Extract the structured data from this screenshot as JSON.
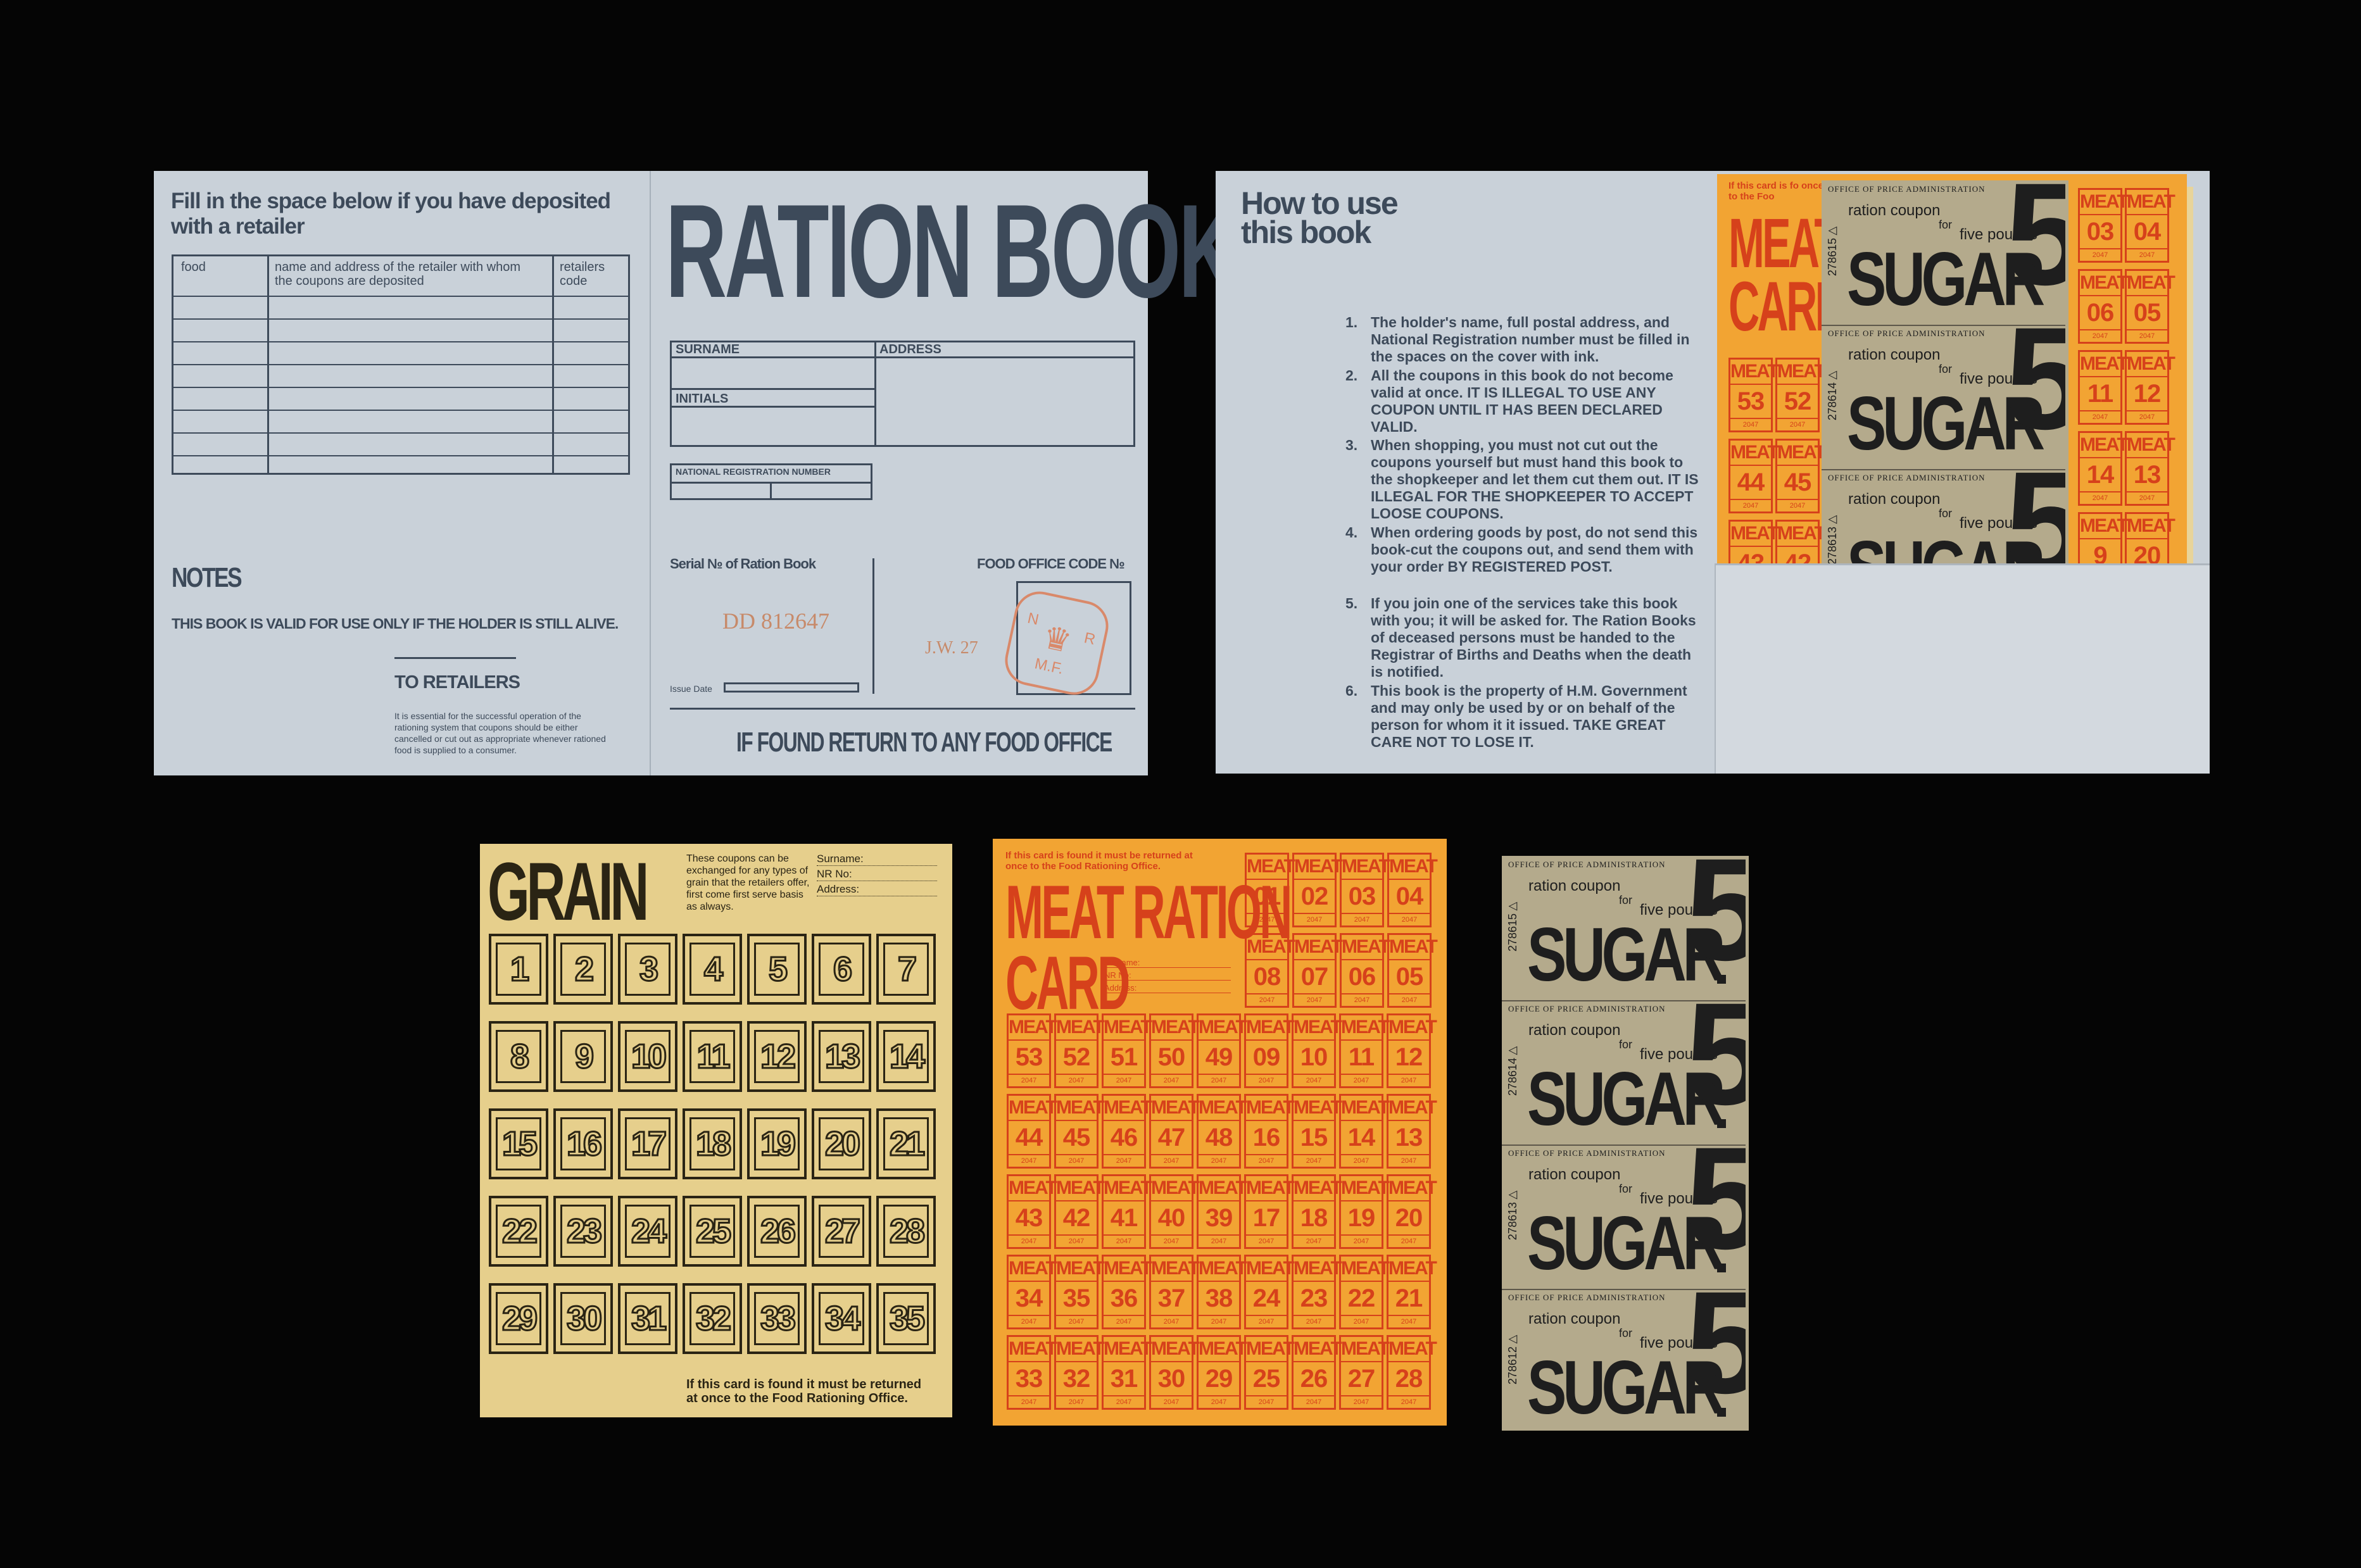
{
  "ration_book_cover": {
    "deposit_heading": "Fill in the space below if you have deposited with a retailer",
    "table_headers": [
      "food",
      "name and address of the retailer with whom the coupons are deposited",
      "retailers code"
    ],
    "notes_title": "NOTES",
    "validity_note": "THIS BOOK IS VALID FOR USE ONLY IF THE HOLDER IS STILL ALIVE.",
    "retailers_title": "TO RETAILERS",
    "retailers_text": "It is essential for the successful operation of the rationing system that coupons should be either cancelled or cut out as appropriate whenever rationed food is supplied to a consumer.",
    "title": "RATION BOOK",
    "field_surname": "SURNAME",
    "field_address": "ADDRESS",
    "field_initials": "INITIALS",
    "field_nrn": "NATIONAL REGISTRATION NUMBER",
    "serial_label": "Serial № of Ration Book",
    "serial_value": "DD 812647",
    "food_office_label": "FOOD OFFICE CODE №",
    "stamp_initials": "J.W. 27",
    "stamp_letters": [
      "N",
      "R",
      "M.F."
    ],
    "issue_date_label": "Issue Date",
    "return_note": "IF FOUND RETURN TO ANY FOOD OFFICE"
  },
  "how_to_use": {
    "title_line1": "How to use",
    "title_line2": "this book",
    "items": [
      "The holder's name, full postal address, and National Registration number must be filled in the spaces on the cover with ink.",
      "All the coupons in this book do not become valid at once. IT IS ILLEGAL TO USE ANY COUPON UNTIL IT HAS BEEN DECLARED VALID.",
      "When shopping, you must not cut out the coupons yourself but must hand this book to the shopkeeper and let them cut them out. IT IS ILLEGAL FOR THE SHOPKEEPER TO ACCEPT LOOSE COUPONS.",
      "When ordering goods by post, do not send this book-cut the coupons out, and send them with your order BY REGISTERED POST.",
      "If you join one of the services take this book with you; it will be asked for. The Ration Books of deceased persons must be handed to the Registrar of Births and Deaths when the death is notified.",
      "This book is the property of H.M. Government and may only be used by or on behalf of the person for whom it it issued. TAKE GREAT CARE NOT TO LOSE IT."
    ],
    "numbers": [
      "1.",
      "2.",
      "3.",
      "4.",
      "5.",
      "6."
    ],
    "peek_meat_numbers": [
      "03",
      "04",
      "06",
      "05",
      "11",
      "12",
      "14",
      "13",
      "9",
      "20"
    ],
    "peek_meat_left": [
      "53",
      "52",
      "44",
      "45",
      "43",
      "42"
    ]
  },
  "grain_card": {
    "title": "GRAIN",
    "info": "These coupons can be exchanged for any types of grain that the retailers offer, first come first serve basis as always.",
    "field_surname": "Surname:",
    "field_nr": "NR No:",
    "field_address": "Address:",
    "numbers": [
      "1",
      "2",
      "3",
      "4",
      "5",
      "6",
      "7",
      "8",
      "9",
      "10",
      "11",
      "12",
      "13",
      "14",
      "15",
      "16",
      "17",
      "18",
      "19",
      "20",
      "21",
      "22",
      "23",
      "24",
      "25",
      "26",
      "27",
      "28",
      "29",
      "30",
      "31",
      "32",
      "33",
      "34",
      "35"
    ],
    "return_note_line1": "If this card is found it must be returned",
    "return_note_line2": "at once to the Food Rationing Office."
  },
  "meat_card": {
    "return_note_line1": "If this card is found it must be returned at",
    "return_note_line2": "once to the Food Rationing Office.",
    "title_line1": "MEAT RATION",
    "title_line2": "CARD",
    "field_surname": "Surname:",
    "field_nr": "NR No:",
    "field_address": "Address:",
    "coupon_word": "MEAT",
    "coupon_year": "2047",
    "top_rows": [
      [
        "01",
        "02",
        "03",
        "04"
      ],
      [
        "08",
        "07",
        "06",
        "05"
      ]
    ],
    "rows": [
      [
        "53",
        "52",
        "51",
        "50",
        "49",
        "09",
        "10",
        "11",
        "12"
      ],
      [
        "44",
        "45",
        "46",
        "47",
        "48",
        "16",
        "15",
        "14",
        "13"
      ],
      [
        "43",
        "42",
        "41",
        "40",
        "39",
        "17",
        "18",
        "19",
        "20"
      ],
      [
        "34",
        "35",
        "36",
        "37",
        "38",
        "24",
        "23",
        "22",
        "21"
      ],
      [
        "33",
        "32",
        "31",
        "30",
        "29",
        "25",
        "26",
        "27",
        "28"
      ]
    ]
  },
  "sugar_strip": {
    "office": "OFFICE OF PRICE ADMINISTRATION",
    "coupon": "ration coupon",
    "for": "for",
    "amount": "five pounds",
    "word": "SUGAR",
    "five": "5",
    "serials": [
      "278615▷",
      "278614▷",
      "278613▷",
      "278612▷"
    ]
  },
  "colors": {
    "background": "#050505",
    "blue_paper": "#c9d1d9",
    "grain_paper": "#e6cf8c",
    "meat_paper": "#f2a433",
    "meat_ink": "#d6411b",
    "sugar_paper": "#b4aa8c"
  }
}
